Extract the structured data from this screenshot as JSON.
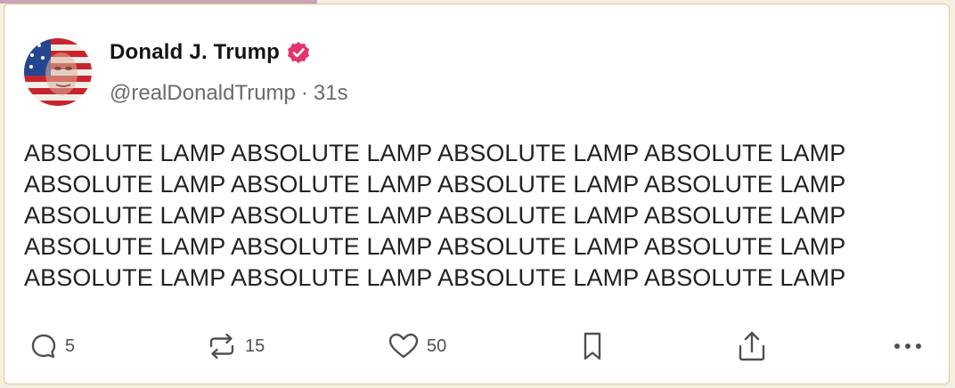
{
  "post": {
    "author": {
      "display_name": "Donald J. Trump",
      "handle": "@realDonaldTrump",
      "separator": "·",
      "time": "31s",
      "verified_icon": "verified-badge-icon",
      "verified_color": "#e6336c"
    },
    "body_lines": [
      "ABSOLUTE LAMP ABSOLUTE LAMP ABSOLUTE LAMP ABSOLUTE LAMP",
      "ABSOLUTE LAMP ABSOLUTE LAMP ABSOLUTE LAMP ABSOLUTE LAMP",
      "ABSOLUTE LAMP ABSOLUTE LAMP ABSOLUTE LAMP ABSOLUTE LAMP",
      "ABSOLUTE LAMP ABSOLUTE LAMP ABSOLUTE LAMP ABSOLUTE LAMP",
      "ABSOLUTE LAMP ABSOLUTE LAMP ABSOLUTE LAMP ABSOLUTE LAMP"
    ],
    "actions": {
      "reply": {
        "icon": "reply-icon",
        "count": "5"
      },
      "repost": {
        "icon": "repost-icon",
        "count": "15"
      },
      "like": {
        "icon": "heart-icon",
        "count": "50"
      },
      "bookmark": {
        "icon": "bookmark-icon"
      },
      "share": {
        "icon": "share-icon"
      },
      "more": {
        "icon": "more-icon"
      }
    }
  }
}
